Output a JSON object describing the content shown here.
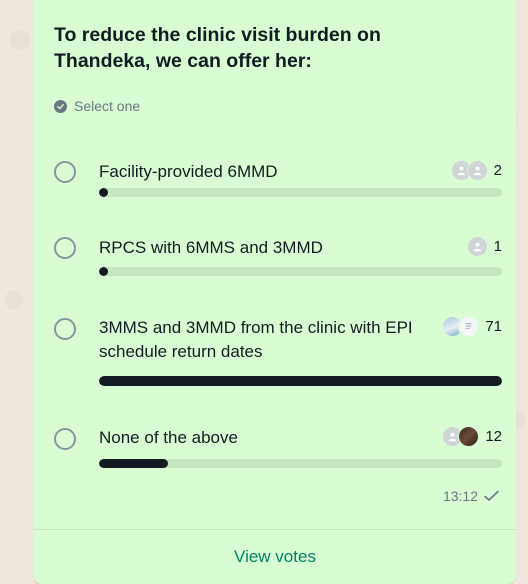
{
  "poll": {
    "question": "To reduce the clinic visit burden on Thandeka, we can offer her:",
    "select_hint": "Select one",
    "options": [
      {
        "label": "Facility-provided 6MMD",
        "votes": "2",
        "fill_fraction": 0.02
      },
      {
        "label": "RPCS with 6MMS and 3MMD",
        "votes": "1",
        "fill_fraction": 0.01
      },
      {
        "label": "3MMS and 3MMD from the clinic with EPI schedule return dates",
        "votes": "71",
        "fill_fraction": 1.0
      },
      {
        "label": "None of the above",
        "votes": "12",
        "fill_fraction": 0.17
      }
    ],
    "timestamp": "13:12",
    "view_votes_label": "View votes"
  },
  "icons": {
    "select_hint": "check-circle-icon",
    "status": "single-check-icon",
    "avatar_placeholder": "person-icon"
  },
  "colors": {
    "bubble": "#d9fdd3",
    "bar_fill": "#111b21",
    "bar_track": "#c5e6bf",
    "link": "#008069",
    "meta_text": "#667781"
  }
}
